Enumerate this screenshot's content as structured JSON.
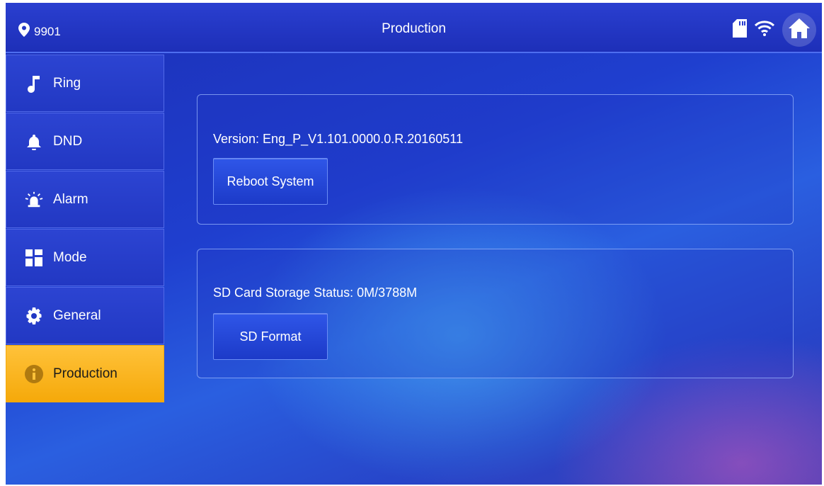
{
  "header": {
    "location": "9901",
    "title": "Production",
    "icons": [
      "location-pin-icon",
      "sd-card-icon",
      "wifi-icon",
      "home-icon"
    ]
  },
  "sidebar": {
    "items": [
      {
        "label": "Ring",
        "icon": "music-note-icon"
      },
      {
        "label": "DND",
        "icon": "bell-icon"
      },
      {
        "label": "Alarm",
        "icon": "alarm-siren-icon"
      },
      {
        "label": "Mode",
        "icon": "grid-icon"
      },
      {
        "label": "General",
        "icon": "gear-icon"
      },
      {
        "label": "Production",
        "icon": "info-icon",
        "active": true
      }
    ]
  },
  "main": {
    "version_text": "Version: Eng_P_V1.101.0000.0.R.20160511",
    "reboot_label": "Reboot System",
    "sd_status_text": "SD Card Storage Status: 0M/3788M",
    "sd_format_label": "SD Format"
  },
  "colors": {
    "accent_active": "#f5a90a",
    "background": "#1f3fcf"
  }
}
